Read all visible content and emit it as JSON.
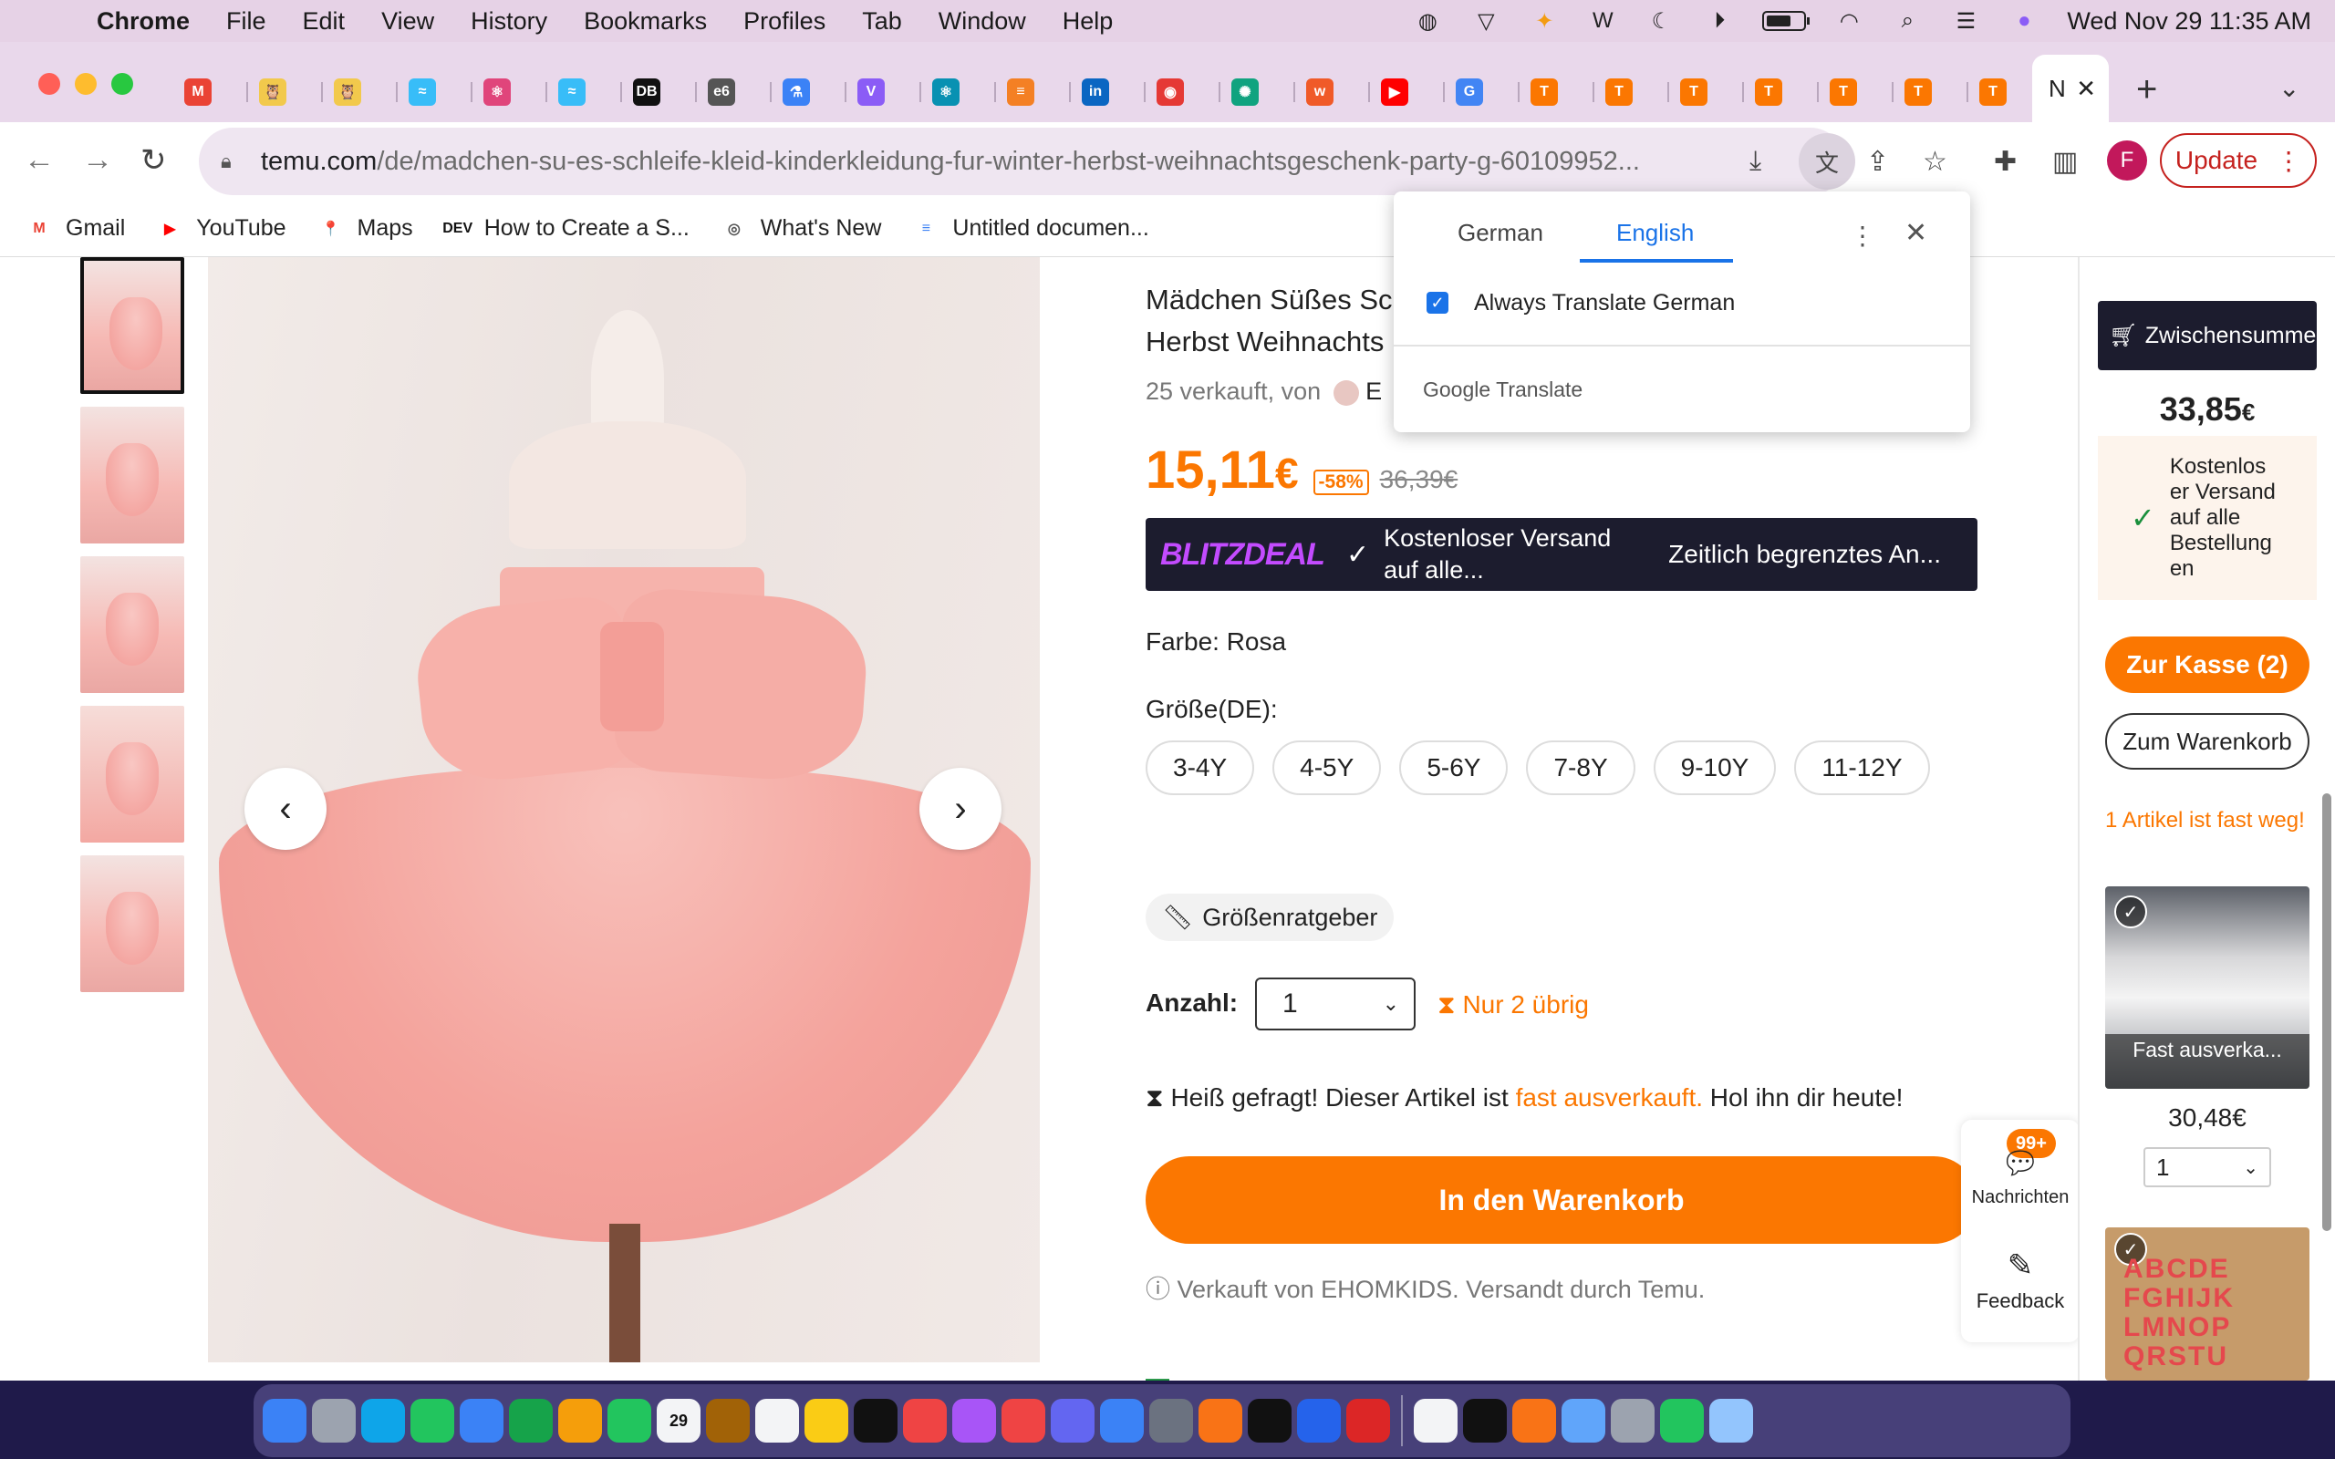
{
  "menubar": {
    "app": "Chrome",
    "items": [
      "File",
      "Edit",
      "View",
      "History",
      "Bookmarks",
      "Profiles",
      "Tab",
      "Window",
      "Help"
    ],
    "datetime": "Wed Nov 29  11:35 AM"
  },
  "tabs": {
    "active_title": "N",
    "favicons": [
      {
        "name": "gmail-icon",
        "glyph": "M",
        "color": "#ea4335"
      },
      {
        "name": "owl-icon",
        "glyph": "🦉",
        "color": "#f2c94c"
      },
      {
        "name": "owl-icon",
        "glyph": "🦉",
        "color": "#f2c94c"
      },
      {
        "name": "tailwind-icon",
        "glyph": "≈",
        "color": "#38bdf8"
      },
      {
        "name": "react-icon",
        "glyph": "⚛",
        "color": "#e0457b"
      },
      {
        "name": "tailwind-icon",
        "glyph": "≈",
        "color": "#38bdf8"
      },
      {
        "name": "db-icon",
        "glyph": "DB",
        "color": "#111111"
      },
      {
        "name": "e6-icon",
        "glyph": "e6",
        "color": "#555555"
      },
      {
        "name": "flask-icon",
        "glyph": "⚗",
        "color": "#3b82f6"
      },
      {
        "name": "vue-icon",
        "glyph": "V",
        "color": "#8b5cf6"
      },
      {
        "name": "react-icon",
        "glyph": "⚛",
        "color": "#0891b2"
      },
      {
        "name": "stackoverflow-icon",
        "glyph": "≡",
        "color": "#f48024"
      },
      {
        "name": "linkedin-icon",
        "glyph": "in",
        "color": "#0a66c2"
      },
      {
        "name": "record-icon",
        "glyph": "◉",
        "color": "#e53935"
      },
      {
        "name": "chatgpt-icon",
        "glyph": "✺",
        "color": "#10a37f"
      },
      {
        "name": "w-icon",
        "glyph": "w",
        "color": "#f05a28"
      },
      {
        "name": "youtube-icon",
        "glyph": "▶",
        "color": "#ff0000"
      },
      {
        "name": "google-icon",
        "glyph": "G",
        "color": "#4285f4"
      },
      {
        "name": "temu-icon",
        "glyph": "T",
        "color": "#fb7701"
      },
      {
        "name": "temu-icon",
        "glyph": "T",
        "color": "#fb7701"
      },
      {
        "name": "temu-icon",
        "glyph": "T",
        "color": "#fb7701"
      },
      {
        "name": "temu-icon",
        "glyph": "T",
        "color": "#fb7701"
      },
      {
        "name": "temu-icon",
        "glyph": "T",
        "color": "#fb7701"
      },
      {
        "name": "temu-icon",
        "glyph": "T",
        "color": "#fb7701"
      },
      {
        "name": "temu-icon",
        "glyph": "T",
        "color": "#fb7701"
      }
    ]
  },
  "omnibox": {
    "host": "temu.com",
    "path": "/de/madchen-su-es-schleife-kleid-kinderkleidung-fur-winter-herbst-weihnachtsgeschenk-party-g-60109952..."
  },
  "toolbar": {
    "profile_initial": "F",
    "update_label": "Update"
  },
  "bookmarks": [
    {
      "label": "Gmail",
      "icon": "gmail-icon",
      "glyph": "M",
      "color": "#ea4335"
    },
    {
      "label": "YouTube",
      "icon": "youtube-icon",
      "glyph": "▶",
      "color": "#ff0000"
    },
    {
      "label": "Maps",
      "icon": "maps-icon",
      "glyph": "📍",
      "color": "#34a853"
    },
    {
      "label": "How to Create a S...",
      "icon": "dev-icon",
      "glyph": "DEV",
      "color": "#111111"
    },
    {
      "label": "What's New",
      "icon": "chrome-icon",
      "glyph": "◎",
      "color": "#555555"
    },
    {
      "label": "Untitled documen...",
      "icon": "docs-icon",
      "glyph": "≡",
      "color": "#4285f4"
    }
  ],
  "translate_popup": {
    "tab_source": "German",
    "tab_target": "English",
    "always_translate": "Always Translate German",
    "footer": "Google Translate"
  },
  "product": {
    "title": "Mädchen Süßes Sc\nHerbst Weihnachts",
    "sold": "25 verkauft, von",
    "seller_initial": "E",
    "price": "15,11",
    "currency": "€",
    "discount": "-58%",
    "old_price": "36,39€",
    "blitz_logo": "BLITZDEAL",
    "blitz_shipping": "Kostenloser Versand auf alle...",
    "blitz_time": "Zeitlich begrenztes An...",
    "color_label": "Farbe: Rosa",
    "size_label": "Größe(DE):",
    "sizes": [
      "3-4Y",
      "4-5Y",
      "5-6Y",
      "7-8Y",
      "9-10Y",
      "11-12Y"
    ],
    "size_guide": "Größenratgeber",
    "qty_label": "Anzahl:",
    "qty_value": "1",
    "stock": "Nur 2 übrig",
    "hot_prefix": "Heiß gefragt! Dieser Artikel ist ",
    "hot_orange": "fast ausverkauft.",
    "hot_suffix": " Hol ihn dir heute!",
    "cart_button": "In den Warenkorb",
    "sold_by": "Verkauft von EHOMKIDS. Versandt durch Temu."
  },
  "side_widget": {
    "badge": "99+",
    "messages": "Nachrichten",
    "feedback": "Feedback"
  },
  "cart": {
    "subtotal_label": "Zwischensumme",
    "subtotal": "33,85",
    "subtotal_currency": "€",
    "shipping": "Kostenlos er Versand auf alle Bestellung en",
    "checkout": "Zur Kasse (2)",
    "to_cart": "Zum Warenkorb",
    "almost_gone": "1 Artikel ist fast weg!",
    "item1_overlay": "Fast ausverka...",
    "item1_price": "30,48€",
    "item1_qty": "1",
    "item2_letters": "ABCDE\nFGHIJK\nLMNOP\nQRSTU"
  },
  "dock": {
    "apps": [
      {
        "name": "finder-icon",
        "color": "#3b82f6"
      },
      {
        "name": "launchpad-icon",
        "color": "#9ca3af"
      },
      {
        "name": "safari-icon",
        "color": "#0ea5e9"
      },
      {
        "name": "messages-icon",
        "color": "#22c55e"
      },
      {
        "name": "mail-icon",
        "color": "#3b82f6"
      },
      {
        "name": "maps-icon",
        "color": "#16a34a"
      },
      {
        "name": "photos-icon",
        "color": "#f59e0b"
      },
      {
        "name": "facetime-icon",
        "color": "#22c55e"
      },
      {
        "name": "calendar-icon",
        "color": "#f3f4f6"
      },
      {
        "name": "contacts-icon",
        "color": "#a16207"
      },
      {
        "name": "reminders-icon",
        "color": "#f3f4f6"
      },
      {
        "name": "notes-icon",
        "color": "#facc15"
      },
      {
        "name": "tv-icon",
        "color": "#111111"
      },
      {
        "name": "music-icon",
        "color": "#ef4444"
      },
      {
        "name": "podcasts-icon",
        "color": "#a855f7"
      },
      {
        "name": "news-icon",
        "color": "#ef4444"
      },
      {
        "name": "teams-icon",
        "color": "#6366f1"
      },
      {
        "name": "appstore-icon",
        "color": "#3b82f6"
      },
      {
        "name": "settings-icon",
        "color": "#6b7280"
      },
      {
        "name": "firefox-icon",
        "color": "#f97316"
      },
      {
        "name": "terminal-icon",
        "color": "#111111"
      },
      {
        "name": "vscode-icon",
        "color": "#2563eb"
      },
      {
        "name": "wps-icon",
        "color": "#dc2626"
      },
      {
        "name": "chrome-icon",
        "color": "#f3f4f6"
      },
      {
        "name": "activity-icon",
        "color": "#111111"
      },
      {
        "name": "postman-icon",
        "color": "#f97316"
      },
      {
        "name": "tableplus-icon",
        "color": "#60a5fa"
      },
      {
        "name": "sequel-icon",
        "color": "#9ca3af"
      },
      {
        "name": "utorrent-icon",
        "color": "#22c55e"
      },
      {
        "name": "preview-icon",
        "color": "#93c5fd"
      }
    ],
    "calendar_day": "29"
  }
}
